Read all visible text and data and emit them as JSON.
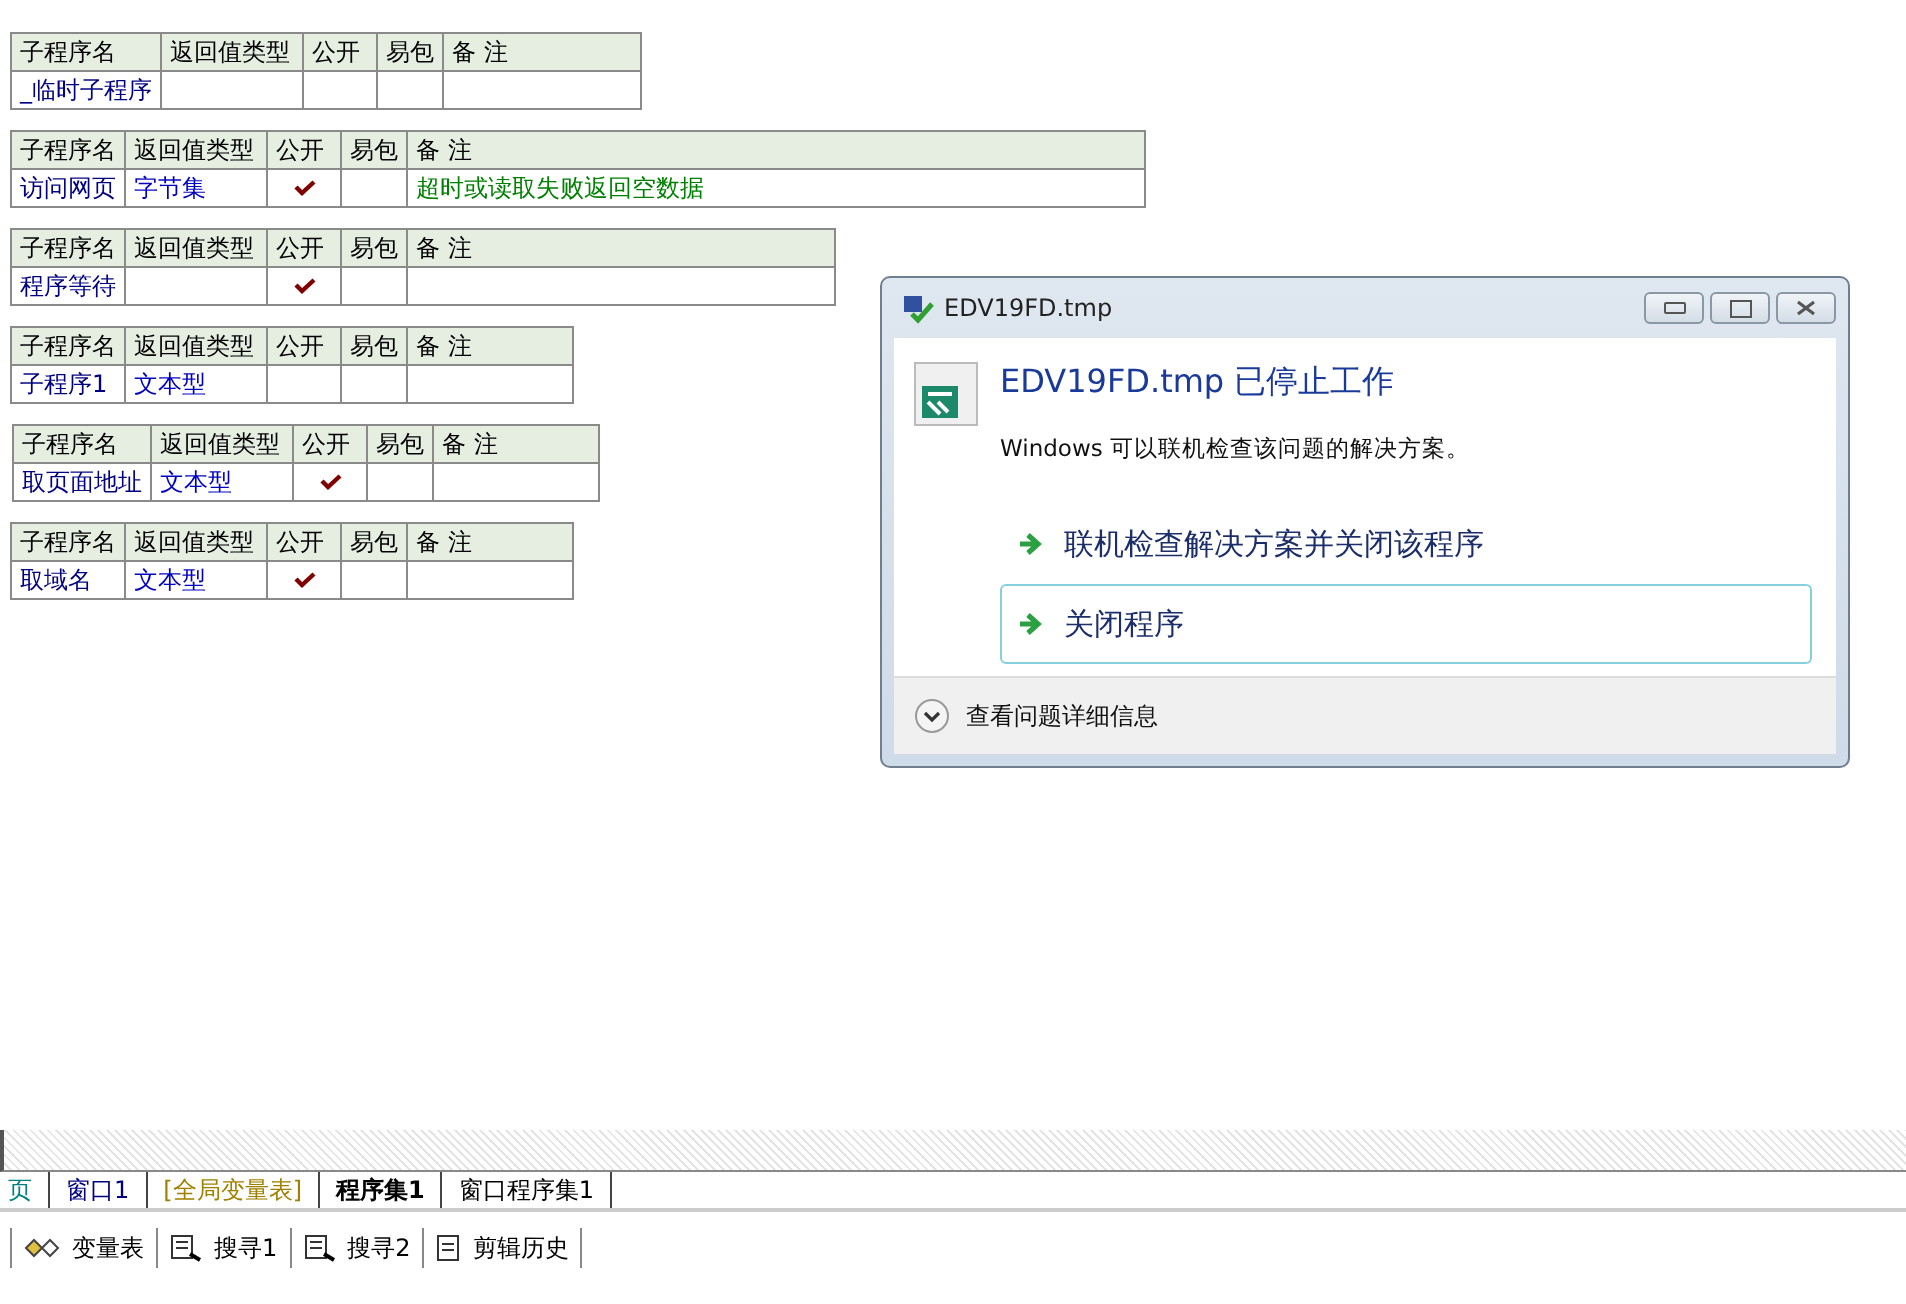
{
  "tables": [
    {
      "columns": [
        "子程序名",
        "返回值类型",
        "公开",
        "易包",
        "备 注"
      ],
      "name": "_临时子程序",
      "public": false
    },
    {
      "columns": [
        "子程序名",
        "返回值类型",
        "公开",
        "易包",
        "备 注"
      ],
      "name": "访问网页",
      "return_type": "字节集",
      "public": true,
      "remark": "超时或读取失败返回空数据"
    },
    {
      "columns": [
        "子程序名",
        "返回值类型",
        "公开",
        "易包",
        "备 注"
      ],
      "name": "程序等待",
      "public": true
    },
    {
      "columns": [
        "子程序名",
        "返回值类型",
        "公开",
        "易包",
        "备 注"
      ],
      "name": "子程序1",
      "return_type": "文本型",
      "public": false
    },
    {
      "columns": [
        "子程序名",
        "返回值类型",
        "公开",
        "易包",
        "备 注"
      ],
      "name": "取页面地址",
      "return_type": "文本型",
      "public": true
    },
    {
      "columns": [
        "子程序名",
        "返回值类型",
        "公开",
        "易包",
        "备 注"
      ],
      "name": "取域名",
      "return_type": "文本型",
      "public": true
    }
  ],
  "dialog": {
    "title": "EDV19FD.tmp",
    "heading": "EDV19FD.tmp 已停止工作",
    "message": "Windows 可以联机检查该问题的解决方案。",
    "options": [
      {
        "label": "联机检查解决方案并关闭该程序",
        "selected": false
      },
      {
        "label": "关闭程序",
        "selected": true
      }
    ],
    "details": "查看问题详细信息"
  },
  "tabs": [
    {
      "label": "页",
      "selected": false,
      "color": "#008080"
    },
    {
      "label": "窗口1",
      "selected": false,
      "color": "#000080"
    },
    {
      "label": "[全局变量表]",
      "selected": false,
      "color": "#a08000"
    },
    {
      "label": "程序集1",
      "selected": true,
      "color": "#000000"
    },
    {
      "label": "窗口程序集1",
      "selected": false,
      "color": "#000000"
    }
  ],
  "toolbar": [
    {
      "label": "变量表",
      "kind": "variables"
    },
    {
      "label": "搜寻1",
      "kind": "search"
    },
    {
      "label": "搜寻2",
      "kind": "search"
    },
    {
      "label": "剪辑历史",
      "kind": "clipboard"
    }
  ]
}
